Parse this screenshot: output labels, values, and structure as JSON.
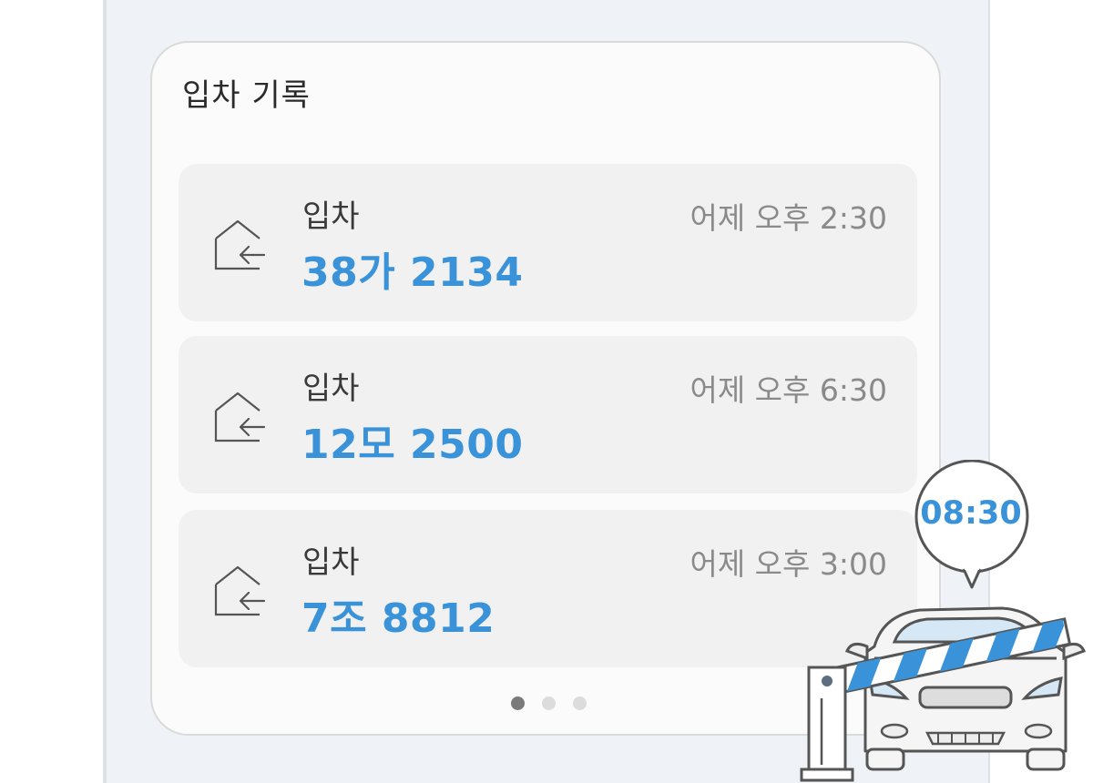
{
  "card": {
    "title": "입차 기록"
  },
  "records": [
    {
      "type": "입차",
      "plate": "38가 2134",
      "time": "어제 오후 2:30",
      "icon": "entry-icon"
    },
    {
      "type": "입차",
      "plate": "12모 2500",
      "time": "어제 오후 6:30",
      "icon": "entry-icon"
    },
    {
      "type": "입차",
      "plate": "7조 8812",
      "time": "어제 오후 3:00",
      "icon": "entry-icon"
    }
  ],
  "pagination": {
    "pages": 3,
    "active": 1
  },
  "illustration": {
    "bubble_time": "08:30",
    "accent_color": "#3a93d9"
  },
  "colors": {
    "accent": "#3a93d9",
    "card_bg": "#fbfbfb",
    "record_bg": "#f1f1f1",
    "page_bg": "#eff3f7"
  }
}
